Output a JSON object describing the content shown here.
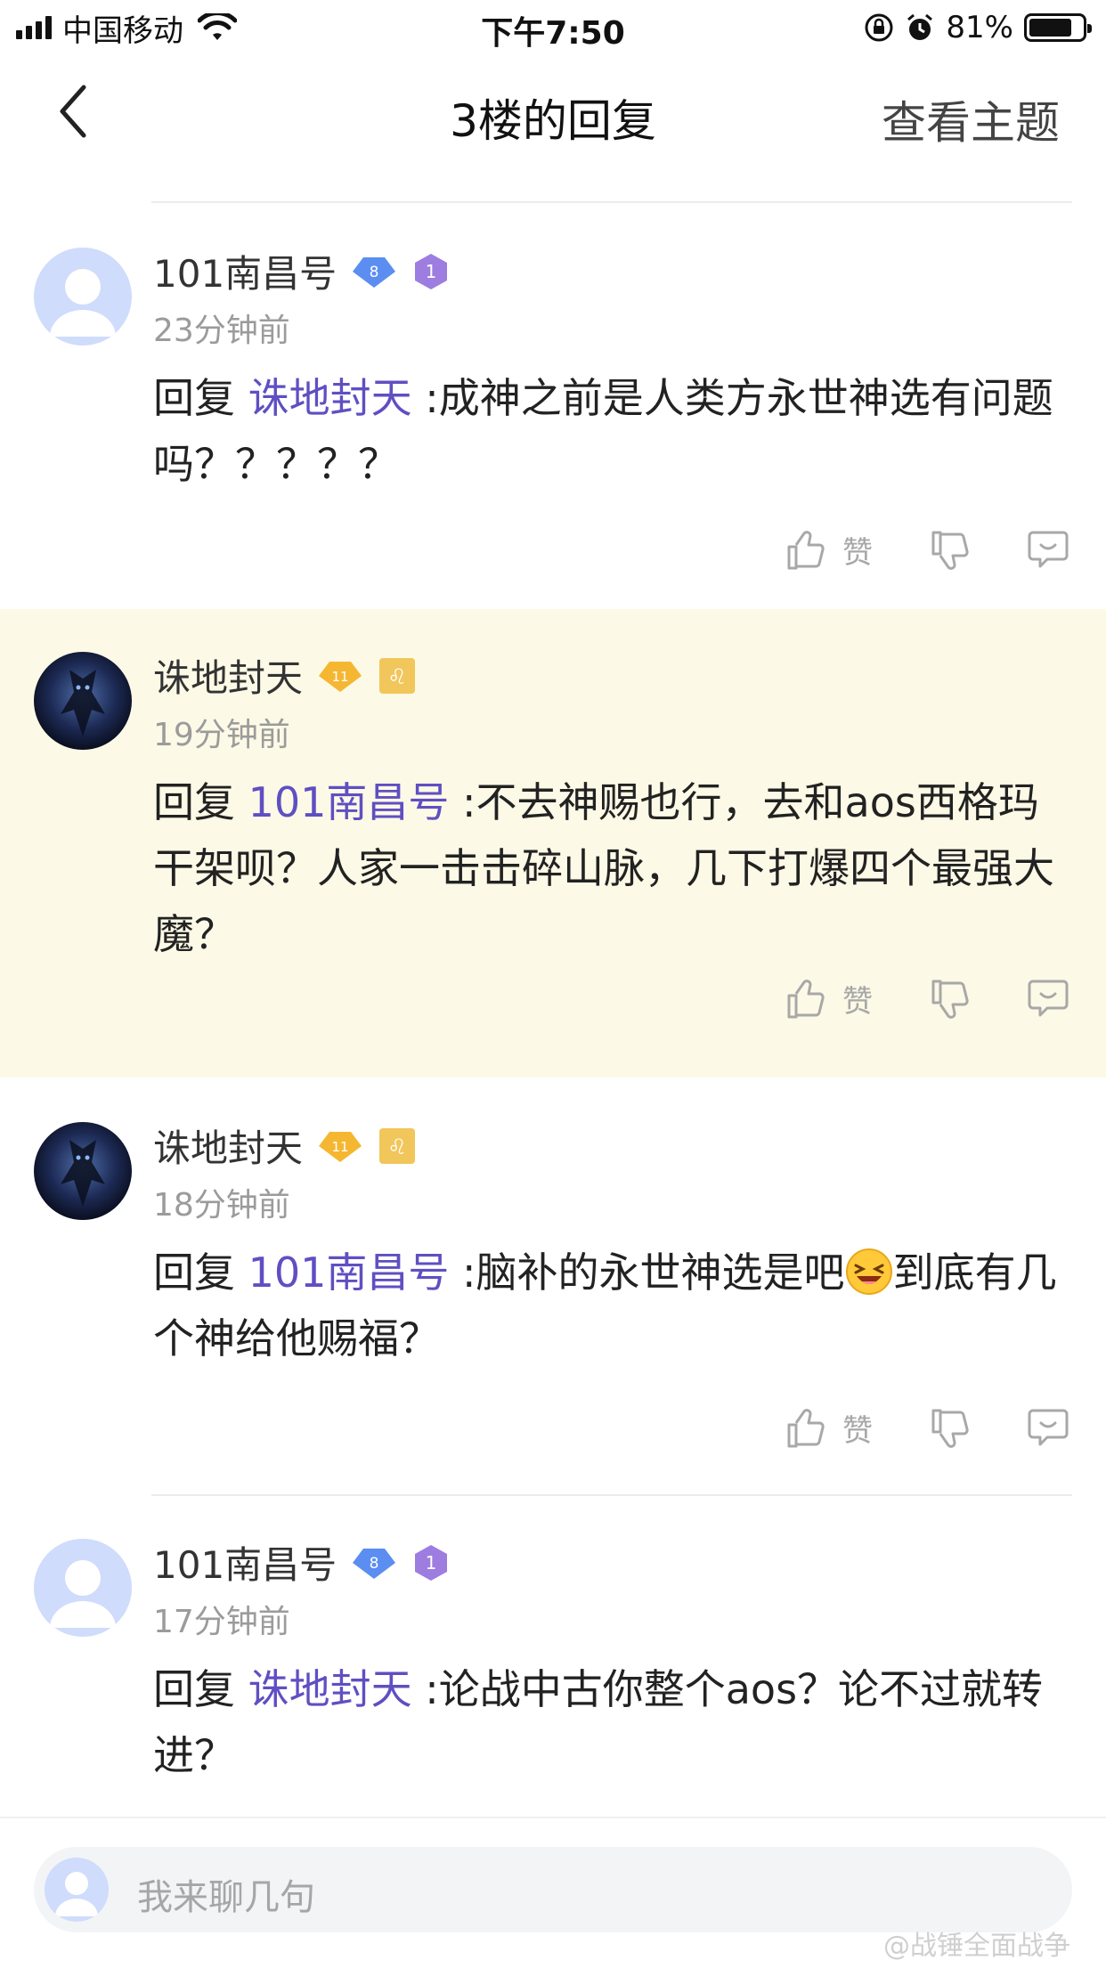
{
  "status_bar": {
    "carrier": "中国移动",
    "time": "下午7:50",
    "battery_percent": "81%",
    "battery_level": 0.81
  },
  "nav": {
    "title": "3楼的回复",
    "right_label": "查看主题"
  },
  "comments": [
    {
      "username": "101南昌号",
      "level_badge": "8",
      "rank_badge": "1",
      "time": "23分钟前",
      "reply_prefix": "回复 ",
      "mention": "诛地封天",
      "content": " :成神之前是人类方永世神选有问题吗？？？？？",
      "like_label": "赞"
    },
    {
      "username": "诛地封天",
      "level_badge": "11",
      "rank_badge": "♌",
      "time": "19分钟前",
      "reply_prefix": "回复 ",
      "mention": "101南昌号",
      "content": " :不去神赐也行，去和aos西格玛干架呗？人家一击击碎山脉，几下打爆四个最强大魔？",
      "like_label": "赞"
    },
    {
      "username": "诛地封天",
      "level_badge": "11",
      "rank_badge": "♌",
      "time": "18分钟前",
      "reply_prefix": "回复 ",
      "mention": "101南昌号",
      "content_before_emoji": " :脑补的永世神选是吧",
      "content_after_emoji": "到底有几个神给他赐福？",
      "like_label": "赞"
    },
    {
      "username": "101南昌号",
      "level_badge": "8",
      "rank_badge": "1",
      "time": "17分钟前",
      "reply_prefix": "回复 ",
      "mention": "诛地封天",
      "content": " :论战中古你整个aos？论不过就转进？"
    }
  ],
  "input": {
    "placeholder": "我来聊几句"
  },
  "watermark": "@战锤全面战争"
}
